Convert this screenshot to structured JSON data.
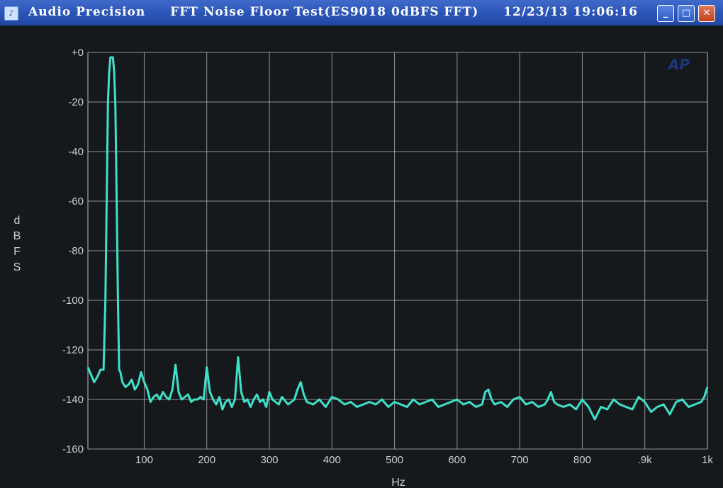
{
  "window": {
    "title_parts": [
      "Audio Precision",
      "FFT Noise Floor Test(ES9018 0dBFS FFT)",
      "12/23/13 19:06:16"
    ],
    "buttons": {
      "minimize": "_",
      "maximize": "□",
      "close": "✕"
    },
    "logo_text": "AP"
  },
  "colors": {
    "trace": "#3ee0c8",
    "grid": "#b8bec2",
    "background": "#16191c",
    "titlebar": "#2a54b6"
  },
  "chart_data": {
    "type": "line",
    "title": "",
    "xlabel": "Hz",
    "ylabel": "dBFS",
    "xlim": [
      10,
      1000
    ],
    "ylim": [
      -160,
      0
    ],
    "x_ticks": [
      100,
      200,
      300,
      400,
      500,
      600,
      700,
      800,
      900,
      1000
    ],
    "x_tick_labels": [
      "100",
      "200",
      "300",
      "400",
      "500",
      "600",
      "700",
      "800",
      ".9k",
      "1k"
    ],
    "y_ticks": [
      0,
      -20,
      -40,
      -60,
      -80,
      -100,
      -120,
      -140,
      -160
    ],
    "y_tick_labels": [
      "+0",
      "-20",
      "-40",
      "-60",
      "-80",
      "-100",
      "-120",
      "-140",
      "-160"
    ],
    "grid": true,
    "series": [
      {
        "x": [
          10,
          15,
          20,
          25,
          30,
          35,
          38,
          40,
          42,
          44,
          46,
          48,
          50,
          52,
          54,
          56,
          58,
          60,
          62,
          65,
          70,
          75,
          80,
          85,
          90,
          95,
          100,
          105,
          110,
          115,
          120,
          125,
          130,
          135,
          140,
          145,
          150,
          155,
          160,
          165,
          170,
          175,
          180,
          185,
          190,
          195,
          200,
          205,
          210,
          215,
          220,
          225,
          230,
          235,
          240,
          245,
          250,
          255,
          260,
          265,
          270,
          275,
          280,
          285,
          290,
          295,
          300,
          305,
          310,
          315,
          320,
          330,
          340,
          345,
          350,
          355,
          360,
          370,
          380,
          390,
          400,
          410,
          420,
          430,
          440,
          450,
          460,
          470,
          480,
          490,
          500,
          510,
          520,
          530,
          540,
          550,
          560,
          570,
          580,
          590,
          600,
          610,
          620,
          630,
          640,
          645,
          650,
          655,
          660,
          670,
          680,
          690,
          700,
          710,
          720,
          730,
          740,
          745,
          750,
          755,
          760,
          770,
          780,
          790,
          800,
          810,
          820,
          830,
          840,
          850,
          860,
          870,
          880,
          890,
          900,
          910,
          920,
          930,
          940,
          950,
          960,
          970,
          980,
          990,
          995,
          1000
        ],
        "y": [
          -127,
          -130,
          -133,
          -131,
          -128,
          -128,
          -100,
          -60,
          -20,
          -8,
          -2,
          -2,
          -2,
          -8,
          -22,
          -60,
          -100,
          -128,
          -129,
          -133,
          -135,
          -134,
          -132,
          -136,
          -134,
          -129,
          -133,
          -136,
          -141,
          -139,
          -138,
          -140,
          -137,
          -139,
          -140,
          -136,
          -126,
          -137,
          -140,
          -139,
          -138,
          -141,
          -140,
          -140,
          -139,
          -140,
          -127,
          -137,
          -140,
          -142,
          -139,
          -144,
          -141,
          -140,
          -143,
          -140,
          -123,
          -137,
          -141,
          -140,
          -143,
          -140,
          -138,
          -141,
          -140,
          -143,
          -137,
          -140,
          -141,
          -142,
          -139,
          -142,
          -140,
          -136,
          -133,
          -138,
          -141,
          -142,
          -140,
          -143,
          -139,
          -140,
          -142,
          -141,
          -143,
          -142,
          -141,
          -142,
          -140,
          -143,
          -141,
          -142,
          -143,
          -140,
          -142,
          -141,
          -140,
          -143,
          -142,
          -141,
          -140,
          -142,
          -141,
          -143,
          -142,
          -137,
          -136,
          -140,
          -142,
          -141,
          -143,
          -140,
          -139,
          -142,
          -141,
          -143,
          -142,
          -140,
          -137,
          -141,
          -142,
          -143,
          -142,
          -144,
          -140,
          -143,
          -148,
          -143,
          -144,
          -140,
          -142,
          -143,
          -144,
          -139,
          -141,
          -145,
          -143,
          -142,
          -146,
          -141,
          -140,
          -143,
          -142,
          -141,
          -139,
          -135
        ]
      }
    ]
  }
}
